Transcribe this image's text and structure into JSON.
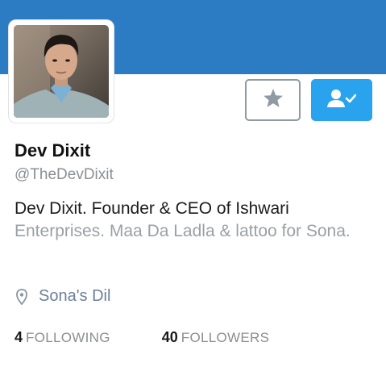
{
  "profile": {
    "name": "Dev Dixit",
    "handle": "@TheDevDixit",
    "bio_line1": "Dev Dixit. Founder & CEO of Ishwari",
    "bio_rest": "Enterprises. Maa Da Ladla & lattoo for Sona.",
    "location": "Sona's Dil"
  },
  "stats": {
    "following_count": "4",
    "following_label": "FOLLOWING",
    "followers_count": "40",
    "followers_label": "FOLLOWERS"
  },
  "buttons": {
    "favorite_icon": "star-icon",
    "follow_icon": "person-check-icon"
  },
  "colors": {
    "banner": "#2b7cc2",
    "follow_button": "#2aa3ef",
    "name": "#111111",
    "muted_text": "#8b8f93",
    "location_text": "#6b8197"
  }
}
